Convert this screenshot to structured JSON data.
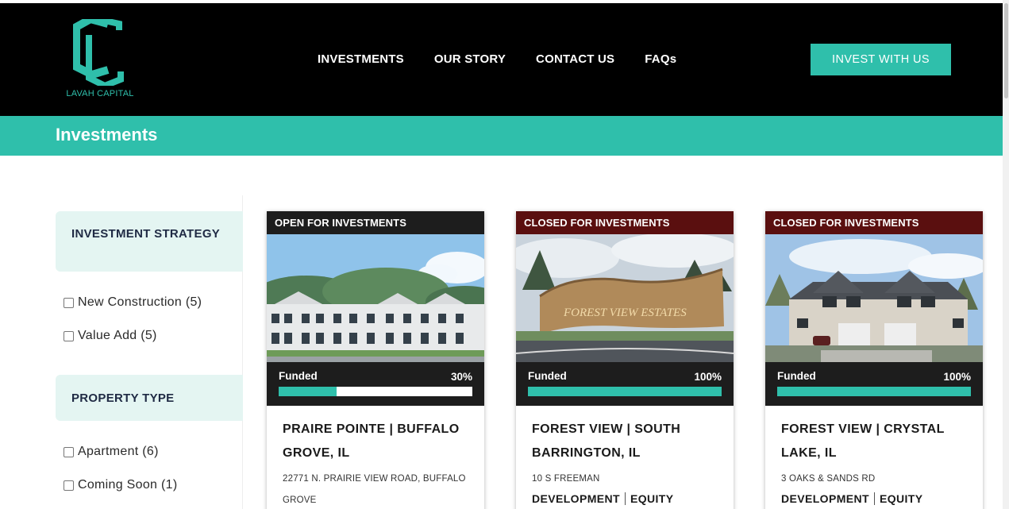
{
  "brand": {
    "name": "LAVAH CAPITAL",
    "accent": "#2fbfab"
  },
  "nav": {
    "items": [
      "INVESTMENTS",
      "OUR STORY",
      "CONTACT US",
      "FAQs"
    ],
    "cta": "INVEST WITH US"
  },
  "page": {
    "title": "Investments"
  },
  "filters": {
    "strategy": {
      "heading": "INVESTMENT STRATEGY",
      "options": [
        {
          "label": "New Construction (5)",
          "checked": false
        },
        {
          "label": "Value Add (5)",
          "checked": false
        }
      ]
    },
    "property_type": {
      "heading": "PROPERTY TYPE",
      "options": [
        {
          "label": "Apartment (6)",
          "checked": false
        },
        {
          "label": "Coming Soon (1)",
          "checked": false
        }
      ]
    }
  },
  "cards": [
    {
      "status": "OPEN FOR INVESTMENTS",
      "status_color": "#1d1d1d",
      "funded_label": "Funded",
      "funded_pct": "30%",
      "funded_fraction": 0.3,
      "title": "PRAIRE POINTE | BUFFALO GROVE, IL",
      "address": "22771 N. PRAIRIE VIEW ROAD, BUFFALO GROVE",
      "tags": []
    },
    {
      "status": "CLOSED FOR INVESTMENTS",
      "status_color": "#5a0f0f",
      "funded_label": "Funded",
      "funded_pct": "100%",
      "funded_fraction": 1.0,
      "title": "FOREST VIEW | SOUTH BARRINGTON, IL",
      "address": "10 S FREEMAN",
      "sign_text": "FOREST VIEW ESTATES",
      "tags": [
        "DEVELOPMENT",
        "EQUITY"
      ]
    },
    {
      "status": "CLOSED FOR INVESTMENTS",
      "status_color": "#5a0f0f",
      "funded_label": "Funded",
      "funded_pct": "100%",
      "funded_fraction": 1.0,
      "title": "FOREST VIEW | CRYSTAL LAKE, IL",
      "address": "3 OAKS & SANDS RD",
      "tags": [
        "DEVELOPMENT",
        "EQUITY"
      ]
    }
  ]
}
